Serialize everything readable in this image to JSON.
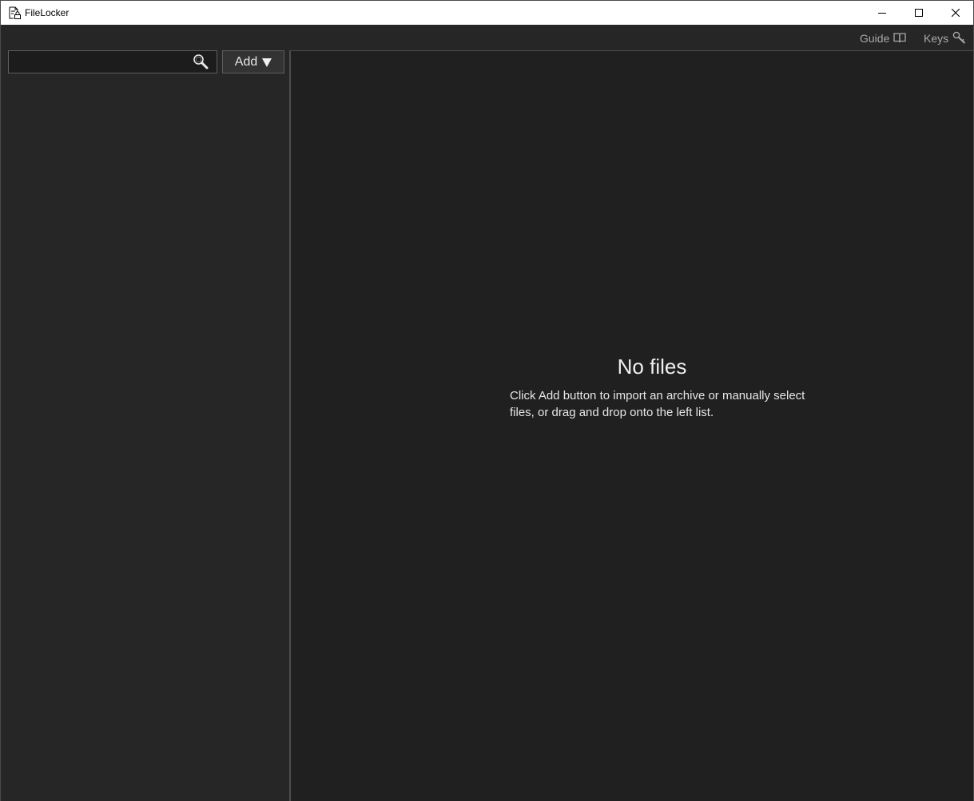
{
  "window": {
    "title": "FileLocker",
    "icons": {
      "app": "file-lock-icon",
      "minimize": "minimize-icon",
      "maximize": "maximize-icon",
      "close": "close-icon"
    }
  },
  "toolbar": {
    "guide_label": "Guide",
    "guide_icon": "book-icon",
    "keys_label": "Keys",
    "keys_icon": "key-icon"
  },
  "sidebar": {
    "search": {
      "value": "",
      "placeholder": "",
      "icon": "search-icon"
    },
    "add_label": "Add",
    "add_icon": "triangle-down-icon",
    "items": []
  },
  "main": {
    "empty_title": "No files",
    "empty_description": "Click Add button to import an archive or manually select files, or drag and drop onto the left list."
  },
  "colors": {
    "background": "#202020",
    "pane": "#262626",
    "text": "#e6e6e6",
    "muted_text": "#a8a8a8",
    "border": "#5e5e5e"
  }
}
